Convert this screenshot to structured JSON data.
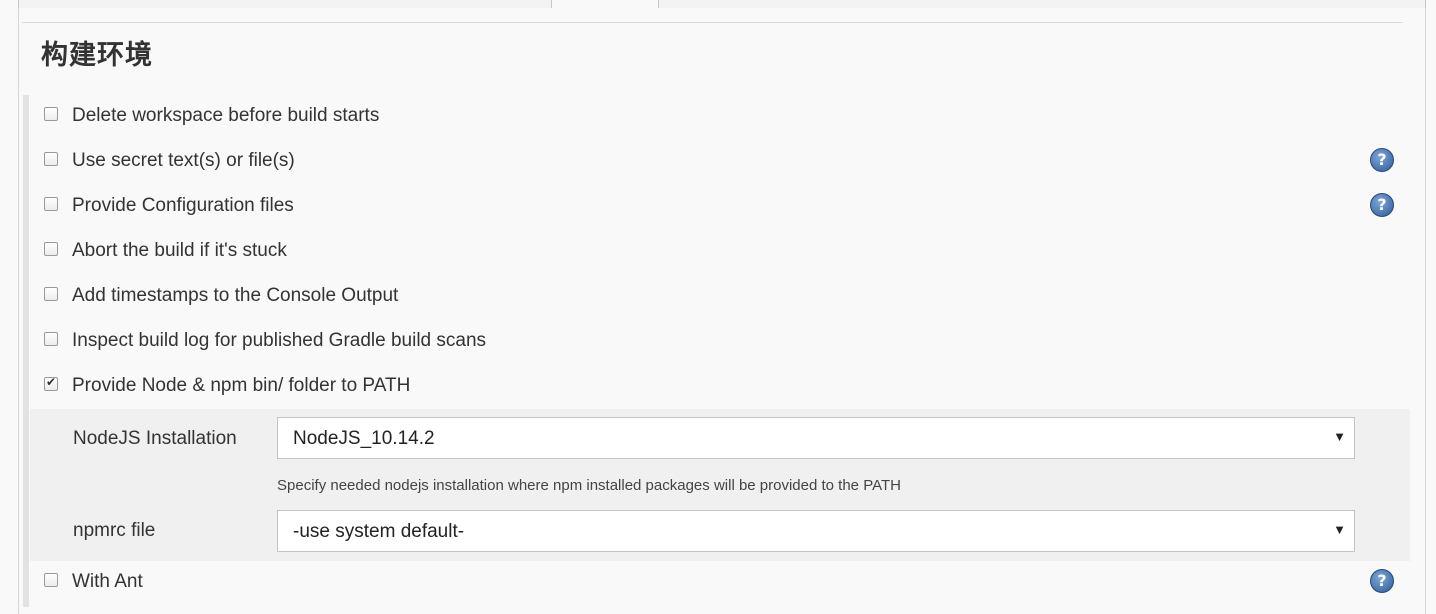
{
  "section": {
    "title": "构建环境"
  },
  "options": [
    {
      "label": "Delete workspace before build starts",
      "checked": false,
      "help": false
    },
    {
      "label": "Use secret text(s) or file(s)",
      "checked": false,
      "help": true
    },
    {
      "label": "Provide Configuration files",
      "checked": false,
      "help": true
    },
    {
      "label": "Abort the build if it's stuck",
      "checked": false,
      "help": false
    },
    {
      "label": "Add timestamps to the Console Output",
      "checked": false,
      "help": false
    },
    {
      "label": "Inspect build log for published Gradle build scans",
      "checked": false,
      "help": false
    },
    {
      "label": "Provide Node & npm bin/ folder to PATH",
      "checked": true,
      "help": false
    },
    {
      "label": "With Ant",
      "checked": false,
      "help": true
    }
  ],
  "nodejs": {
    "installation_label": "NodeJS Installation",
    "installation_value": "NodeJS_10.14.2",
    "hint": "Specify needed nodejs installation where npm installed packages will be provided to the PATH",
    "npmrc_label": "npmrc file",
    "npmrc_value": "-use system default-",
    "arrow": "▼"
  },
  "help_glyph": "?",
  "icons": {
    "help": "help-icon",
    "checkbox_check": "check-icon",
    "dropdown": "dropdown-arrow-icon"
  }
}
